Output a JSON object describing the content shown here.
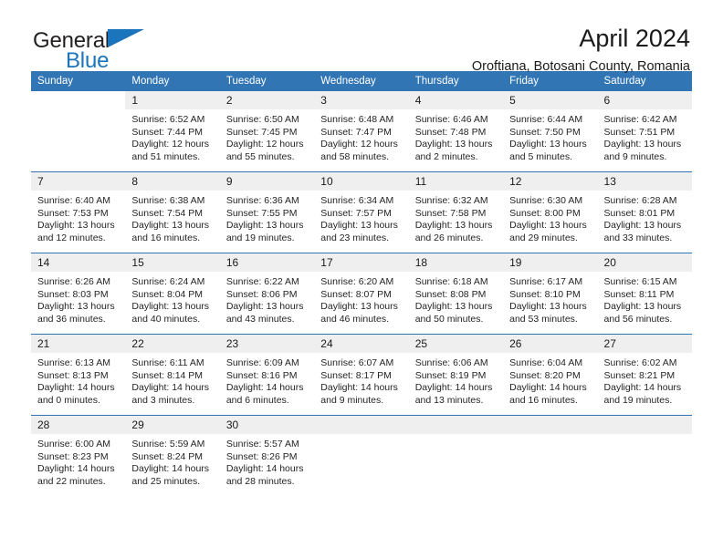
{
  "brand": {
    "line1": "General",
    "line2": "Blue",
    "logo_icon": "triangle-flag-icon",
    "color_dark": "#221f1f",
    "color_blue": "#1b75bc"
  },
  "header": {
    "title": "April 2024",
    "subtitle": "Oroftiana, Botosani County, Romania"
  },
  "theme": {
    "header_bg": "#3175b4",
    "daynum_bg": "#efefef",
    "grid_line": "#3175b4",
    "text": "#242424"
  },
  "weekday_headers": [
    "Sunday",
    "Monday",
    "Tuesday",
    "Wednesday",
    "Thursday",
    "Friday",
    "Saturday"
  ],
  "labels": {
    "sunrise": "Sunrise:",
    "sunset": "Sunset:",
    "daylight": "Daylight:"
  },
  "weeks": [
    [
      {
        "day": "",
        "empty": true,
        "shaded": false,
        "sunrise": "",
        "sunset": "",
        "daylight_a": "",
        "daylight_b": ""
      },
      {
        "day": "1",
        "empty": false,
        "shaded": true,
        "sunrise": "Sunrise: 6:52 AM",
        "sunset": "Sunset: 7:44 PM",
        "daylight_a": "Daylight: 12 hours",
        "daylight_b": "and 51 minutes."
      },
      {
        "day": "2",
        "empty": false,
        "shaded": true,
        "sunrise": "Sunrise: 6:50 AM",
        "sunset": "Sunset: 7:45 PM",
        "daylight_a": "Daylight: 12 hours",
        "daylight_b": "and 55 minutes."
      },
      {
        "day": "3",
        "empty": false,
        "shaded": true,
        "sunrise": "Sunrise: 6:48 AM",
        "sunset": "Sunset: 7:47 PM",
        "daylight_a": "Daylight: 12 hours",
        "daylight_b": "and 58 minutes."
      },
      {
        "day": "4",
        "empty": false,
        "shaded": true,
        "sunrise": "Sunrise: 6:46 AM",
        "sunset": "Sunset: 7:48 PM",
        "daylight_a": "Daylight: 13 hours",
        "daylight_b": "and 2 minutes."
      },
      {
        "day": "5",
        "empty": false,
        "shaded": true,
        "sunrise": "Sunrise: 6:44 AM",
        "sunset": "Sunset: 7:50 PM",
        "daylight_a": "Daylight: 13 hours",
        "daylight_b": "and 5 minutes."
      },
      {
        "day": "6",
        "empty": false,
        "shaded": true,
        "sunrise": "Sunrise: 6:42 AM",
        "sunset": "Sunset: 7:51 PM",
        "daylight_a": "Daylight: 13 hours",
        "daylight_b": "and 9 minutes."
      }
    ],
    [
      {
        "day": "7",
        "empty": false,
        "shaded": true,
        "sunrise": "Sunrise: 6:40 AM",
        "sunset": "Sunset: 7:53 PM",
        "daylight_a": "Daylight: 13 hours",
        "daylight_b": "and 12 minutes."
      },
      {
        "day": "8",
        "empty": false,
        "shaded": true,
        "sunrise": "Sunrise: 6:38 AM",
        "sunset": "Sunset: 7:54 PM",
        "daylight_a": "Daylight: 13 hours",
        "daylight_b": "and 16 minutes."
      },
      {
        "day": "9",
        "empty": false,
        "shaded": true,
        "sunrise": "Sunrise: 6:36 AM",
        "sunset": "Sunset: 7:55 PM",
        "daylight_a": "Daylight: 13 hours",
        "daylight_b": "and 19 minutes."
      },
      {
        "day": "10",
        "empty": false,
        "shaded": true,
        "sunrise": "Sunrise: 6:34 AM",
        "sunset": "Sunset: 7:57 PM",
        "daylight_a": "Daylight: 13 hours",
        "daylight_b": "and 23 minutes."
      },
      {
        "day": "11",
        "empty": false,
        "shaded": true,
        "sunrise": "Sunrise: 6:32 AM",
        "sunset": "Sunset: 7:58 PM",
        "daylight_a": "Daylight: 13 hours",
        "daylight_b": "and 26 minutes."
      },
      {
        "day": "12",
        "empty": false,
        "shaded": true,
        "sunrise": "Sunrise: 6:30 AM",
        "sunset": "Sunset: 8:00 PM",
        "daylight_a": "Daylight: 13 hours",
        "daylight_b": "and 29 minutes."
      },
      {
        "day": "13",
        "empty": false,
        "shaded": true,
        "sunrise": "Sunrise: 6:28 AM",
        "sunset": "Sunset: 8:01 PM",
        "daylight_a": "Daylight: 13 hours",
        "daylight_b": "and 33 minutes."
      }
    ],
    [
      {
        "day": "14",
        "empty": false,
        "shaded": true,
        "sunrise": "Sunrise: 6:26 AM",
        "sunset": "Sunset: 8:03 PM",
        "daylight_a": "Daylight: 13 hours",
        "daylight_b": "and 36 minutes."
      },
      {
        "day": "15",
        "empty": false,
        "shaded": true,
        "sunrise": "Sunrise: 6:24 AM",
        "sunset": "Sunset: 8:04 PM",
        "daylight_a": "Daylight: 13 hours",
        "daylight_b": "and 40 minutes."
      },
      {
        "day": "16",
        "empty": false,
        "shaded": true,
        "sunrise": "Sunrise: 6:22 AM",
        "sunset": "Sunset: 8:06 PM",
        "daylight_a": "Daylight: 13 hours",
        "daylight_b": "and 43 minutes."
      },
      {
        "day": "17",
        "empty": false,
        "shaded": true,
        "sunrise": "Sunrise: 6:20 AM",
        "sunset": "Sunset: 8:07 PM",
        "daylight_a": "Daylight: 13 hours",
        "daylight_b": "and 46 minutes."
      },
      {
        "day": "18",
        "empty": false,
        "shaded": true,
        "sunrise": "Sunrise: 6:18 AM",
        "sunset": "Sunset: 8:08 PM",
        "daylight_a": "Daylight: 13 hours",
        "daylight_b": "and 50 minutes."
      },
      {
        "day": "19",
        "empty": false,
        "shaded": true,
        "sunrise": "Sunrise: 6:17 AM",
        "sunset": "Sunset: 8:10 PM",
        "daylight_a": "Daylight: 13 hours",
        "daylight_b": "and 53 minutes."
      },
      {
        "day": "20",
        "empty": false,
        "shaded": true,
        "sunrise": "Sunrise: 6:15 AM",
        "sunset": "Sunset: 8:11 PM",
        "daylight_a": "Daylight: 13 hours",
        "daylight_b": "and 56 minutes."
      }
    ],
    [
      {
        "day": "21",
        "empty": false,
        "shaded": true,
        "sunrise": "Sunrise: 6:13 AM",
        "sunset": "Sunset: 8:13 PM",
        "daylight_a": "Daylight: 14 hours",
        "daylight_b": "and 0 minutes."
      },
      {
        "day": "22",
        "empty": false,
        "shaded": true,
        "sunrise": "Sunrise: 6:11 AM",
        "sunset": "Sunset: 8:14 PM",
        "daylight_a": "Daylight: 14 hours",
        "daylight_b": "and 3 minutes."
      },
      {
        "day": "23",
        "empty": false,
        "shaded": true,
        "sunrise": "Sunrise: 6:09 AM",
        "sunset": "Sunset: 8:16 PM",
        "daylight_a": "Daylight: 14 hours",
        "daylight_b": "and 6 minutes."
      },
      {
        "day": "24",
        "empty": false,
        "shaded": true,
        "sunrise": "Sunrise: 6:07 AM",
        "sunset": "Sunset: 8:17 PM",
        "daylight_a": "Daylight: 14 hours",
        "daylight_b": "and 9 minutes."
      },
      {
        "day": "25",
        "empty": false,
        "shaded": true,
        "sunrise": "Sunrise: 6:06 AM",
        "sunset": "Sunset: 8:19 PM",
        "daylight_a": "Daylight: 14 hours",
        "daylight_b": "and 13 minutes."
      },
      {
        "day": "26",
        "empty": false,
        "shaded": true,
        "sunrise": "Sunrise: 6:04 AM",
        "sunset": "Sunset: 8:20 PM",
        "daylight_a": "Daylight: 14 hours",
        "daylight_b": "and 16 minutes."
      },
      {
        "day": "27",
        "empty": false,
        "shaded": true,
        "sunrise": "Sunrise: 6:02 AM",
        "sunset": "Sunset: 8:21 PM",
        "daylight_a": "Daylight: 14 hours",
        "daylight_b": "and 19 minutes."
      }
    ],
    [
      {
        "day": "28",
        "empty": false,
        "shaded": true,
        "sunrise": "Sunrise: 6:00 AM",
        "sunset": "Sunset: 8:23 PM",
        "daylight_a": "Daylight: 14 hours",
        "daylight_b": "and 22 minutes."
      },
      {
        "day": "29",
        "empty": false,
        "shaded": true,
        "sunrise": "Sunrise: 5:59 AM",
        "sunset": "Sunset: 8:24 PM",
        "daylight_a": "Daylight: 14 hours",
        "daylight_b": "and 25 minutes."
      },
      {
        "day": "30",
        "empty": false,
        "shaded": true,
        "sunrise": "Sunrise: 5:57 AM",
        "sunset": "Sunset: 8:26 PM",
        "daylight_a": "Daylight: 14 hours",
        "daylight_b": "and 28 minutes."
      },
      {
        "day": "",
        "empty": true,
        "shaded": true,
        "sunrise": "",
        "sunset": "",
        "daylight_a": "",
        "daylight_b": ""
      },
      {
        "day": "",
        "empty": true,
        "shaded": true,
        "sunrise": "",
        "sunset": "",
        "daylight_a": "",
        "daylight_b": ""
      },
      {
        "day": "",
        "empty": true,
        "shaded": true,
        "sunrise": "",
        "sunset": "",
        "daylight_a": "",
        "daylight_b": ""
      },
      {
        "day": "",
        "empty": true,
        "shaded": true,
        "sunrise": "",
        "sunset": "",
        "daylight_a": "",
        "daylight_b": ""
      }
    ]
  ]
}
